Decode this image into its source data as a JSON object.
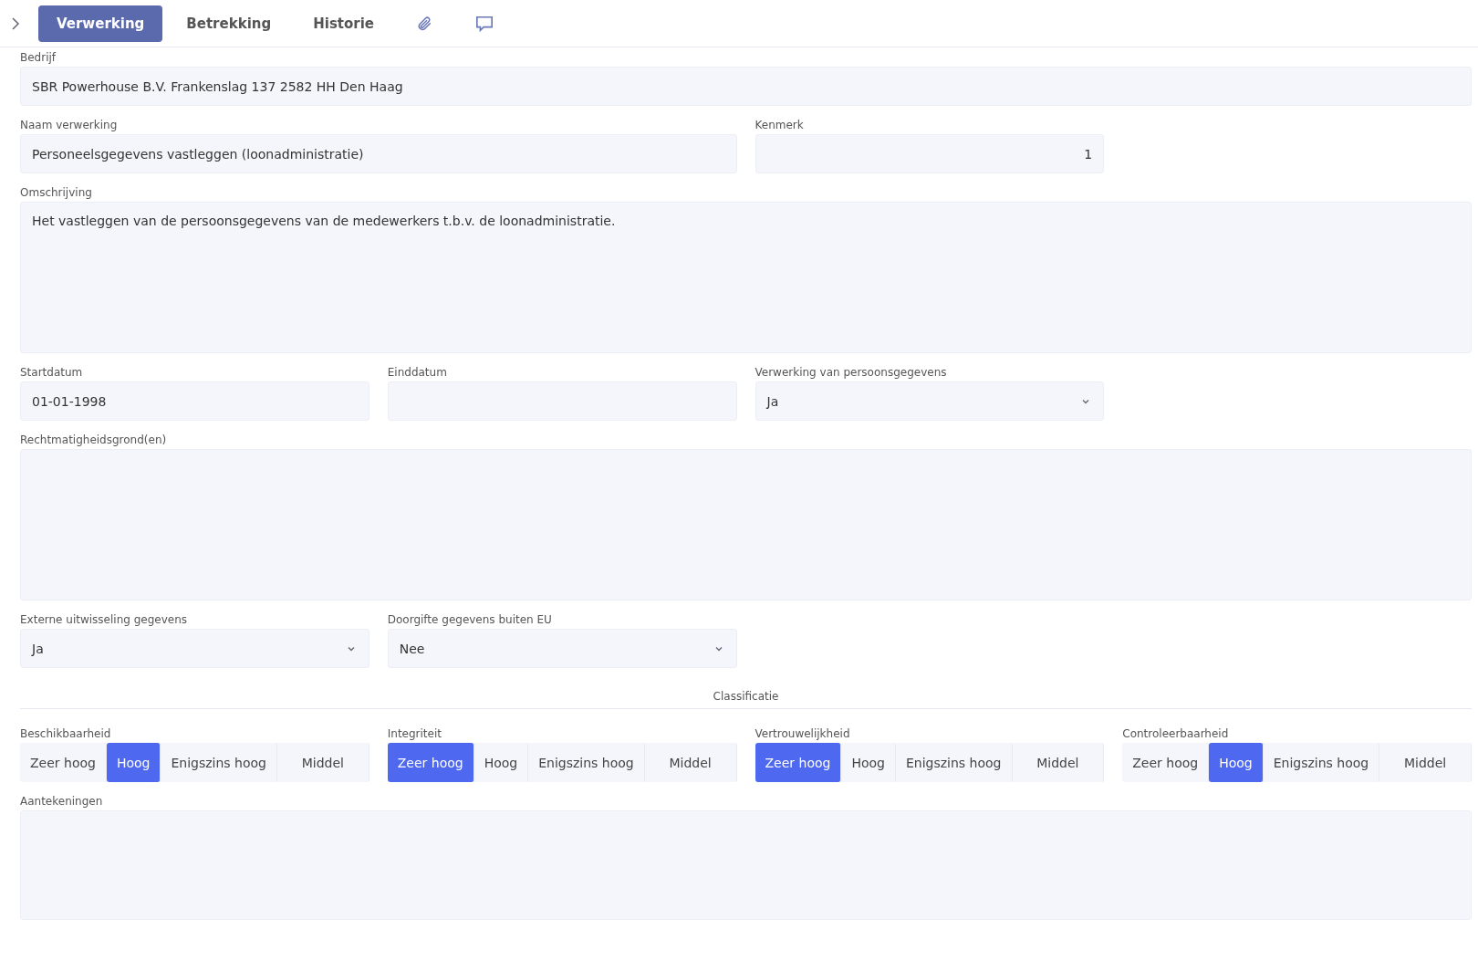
{
  "tabs": [
    {
      "kind": "text",
      "label": "Verwerking",
      "selected": true
    },
    {
      "kind": "text",
      "label": "Betrekking",
      "selected": false
    },
    {
      "kind": "text",
      "label": "Historie",
      "selected": false
    },
    {
      "kind": "attachments",
      "selected": false
    },
    {
      "kind": "comments",
      "selected": false
    }
  ],
  "bedrijf": {
    "label": "Bedrijf",
    "value": "SBR Powerhouse B.V. Frankenslag 137 2582 HH Den Haag"
  },
  "naam_verwerking": {
    "label": "Naam verwerking",
    "value": "Personeelsgegevens vastleggen (loonadministratie)"
  },
  "kenmerk": {
    "label": "Kenmerk",
    "value": "1"
  },
  "omschrijving": {
    "label": "Omschrijving",
    "value": "Het vastleggen van de persoonsgegevens van de medewerkers t.b.v. de loonadministratie."
  },
  "startdatum": {
    "label": "Startdatum",
    "value": "01-01-1998"
  },
  "einddatum": {
    "label": "Einddatum"
  },
  "verwerking_persoonsgegevens": {
    "label": "Verwerking van persoonsgegevens",
    "value": "Ja"
  },
  "rechtmatigheidsgronden": {
    "label": "Rechtmatigheidsgrond(en)"
  },
  "externe_uitwisseling": {
    "label": "Externe uitwisseling gegevens",
    "value": "Ja"
  },
  "doorgifte_buiten_eu": {
    "label": "Doorgifte gegevens buiten EU",
    "value": "Nee"
  },
  "classificatie": {
    "title": "Classificatie",
    "groups": [
      {
        "label": "Beschikbaarheid",
        "options": [
          {
            "label": "Zeer hoog",
            "selected": false
          },
          {
            "label": "Hoog",
            "selected": true
          },
          {
            "label": "Enigszins hoog",
            "selected": false
          },
          {
            "label": "Middel",
            "selected": false
          }
        ]
      },
      {
        "label": "Integriteit",
        "options": [
          {
            "label": "Zeer hoog",
            "selected": true
          },
          {
            "label": "Hoog",
            "selected": false
          },
          {
            "label": "Enigszins hoog",
            "selected": false
          },
          {
            "label": "Middel",
            "selected": false
          }
        ]
      },
      {
        "label": "Vertrouwelijkheid",
        "options": [
          {
            "label": "Zeer hoog",
            "selected": true
          },
          {
            "label": "Hoog",
            "selected": false
          },
          {
            "label": "Enigszins hoog",
            "selected": false
          },
          {
            "label": "Middel",
            "selected": false
          }
        ]
      },
      {
        "label": "Controleerbaarheid",
        "options": [
          {
            "label": "Zeer hoog",
            "selected": false
          },
          {
            "label": "Hoog",
            "selected": true
          },
          {
            "label": "Enigszins hoog",
            "selected": false
          },
          {
            "label": "Middel",
            "selected": false
          }
        ]
      }
    ]
  },
  "aantekeningen": {
    "label": "Aantekeningen"
  }
}
